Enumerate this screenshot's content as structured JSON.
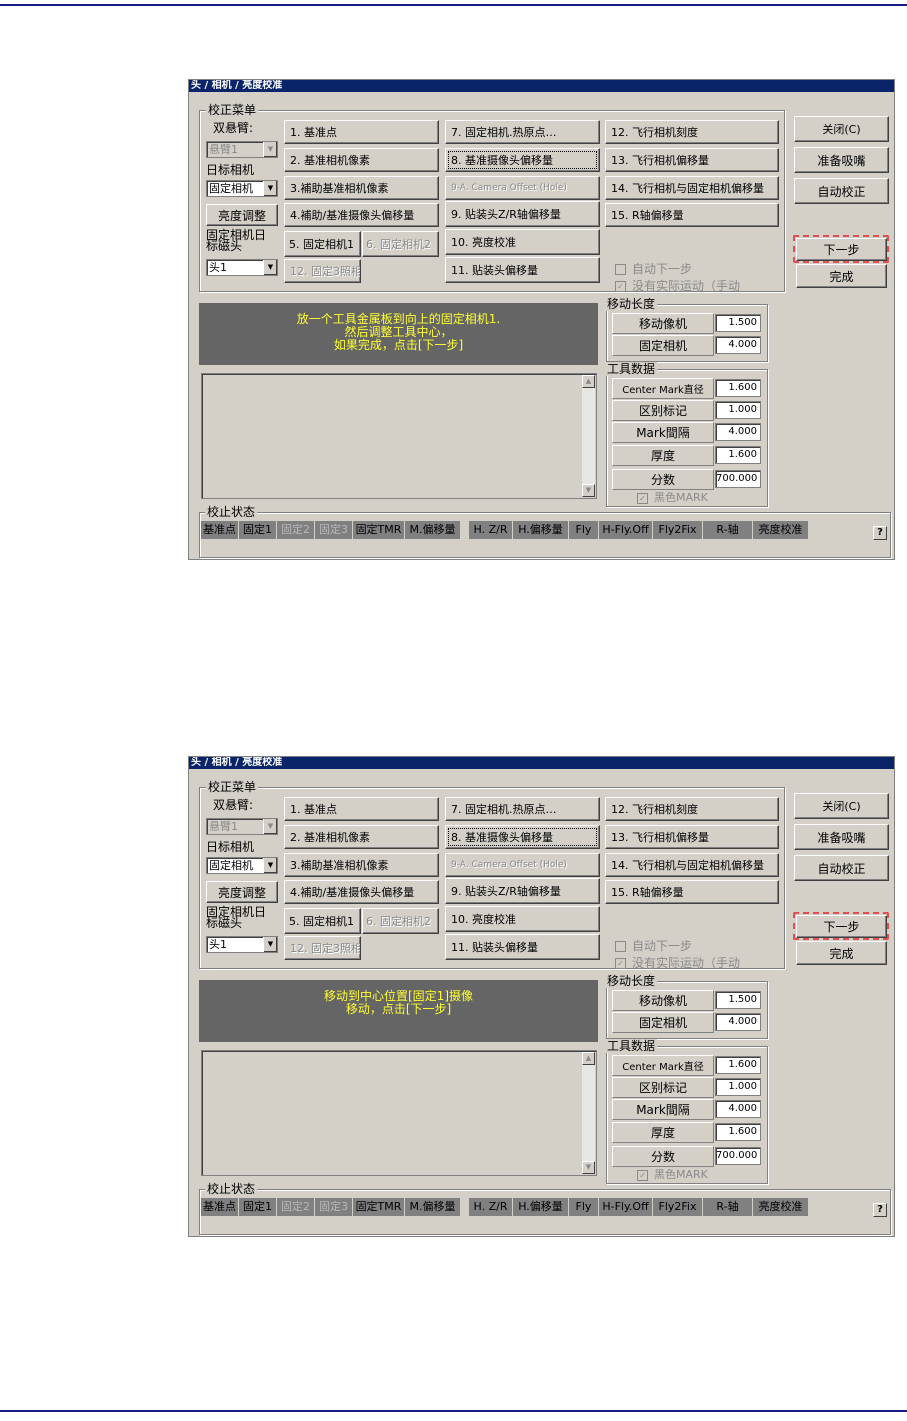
{
  "colors": {
    "title_bar": "#0a246a",
    "message_bg": "#656565",
    "message_text": "#ffff33",
    "highlight": "#e05050"
  },
  "screens": [
    {
      "title": "头 / 相机 / 亮度校准",
      "menu_group": "校正菜单",
      "dual_arm_label": "双悬臂:",
      "arm_select": "悬臂1",
      "target_camera_label": "日标相机",
      "target_camera_select": "固定相机",
      "brightness_button": "亮度调整",
      "fixed_camera_label": "固定相机日标磁头",
      "head_select": "头1",
      "col1": [
        "1. 基准点",
        "2. 基准相机像素",
        "3.補助基准相机像素",
        "4.補助/基准摄像头偏移量"
      ],
      "fixed_cam1": "5. 固定相机1",
      "fixed_cam2": "6. 固定相机2",
      "fixed_cam3": "12. 固定3照相",
      "col2": [
        "7. 固定相机.热原点…",
        "8. 基准摄像头偏移量",
        "9-A. Camera Offset (Hole)",
        "9. 贴装头Z/R轴偏移量",
        "10. 亮度校准",
        "11. 贴装头偏移量"
      ],
      "col3": [
        "12. 飞行相机刻度",
        "13. 飞行相机偏移量",
        "14. 飞行相机与固定相机偏移量",
        "15. R轴偏移量"
      ],
      "auto_next": "自动下一步",
      "no_motion": "没有实际运动（手动",
      "close": "关闭(C)",
      "prepare_nozzle": "准备吸嘴",
      "auto_calibrate": "自动校正",
      "next_step": "下一步",
      "done": "完成",
      "message": [
        "放一个工具金属板到向上的固定相机1.",
        "然后调整工具中心，",
        "如果完成，点击[下一步]"
      ],
      "move_length_group": "移动长度",
      "move_camera_label": "移动像机",
      "move_camera_value": "1.500",
      "fixed_camera_move_label": "固定相机",
      "fixed_camera_move_value": "4.000",
      "tool_data_group": "工具数据",
      "tool_rows": [
        {
          "label": "Center Mark直径",
          "value": "1.600"
        },
        {
          "label": "区别标记",
          "value": "1.000"
        },
        {
          "label": "Mark間隔",
          "value": "4.000"
        },
        {
          "label": "厚度",
          "value": "1.600"
        },
        {
          "label": "分数",
          "value": "700.000"
        }
      ],
      "black_mark": "黑色MARK",
      "status_group": "校止状态",
      "status": [
        "基准点",
        "固定1",
        "固定2",
        "固定3",
        "固定TMR",
        "M.偏移量",
        "H. Z/R",
        "H.偏移量",
        "Fly",
        "H-Fly.Off",
        "Fly2Fix",
        "R-轴",
        "亮度校准"
      ],
      "help": "?"
    },
    {
      "title": "头 / 相机 / 亮度校准",
      "menu_group": "校正菜单",
      "dual_arm_label": "双悬臂:",
      "arm_select": "悬臂1",
      "target_camera_label": "日标相机",
      "target_camera_select": "固定相机",
      "brightness_button": "亮度调整",
      "fixed_camera_label": "固定相机日标磁头",
      "head_select": "头1",
      "col1": [
        "1. 基准点",
        "2. 基准相机像素",
        "3.補助基准相机像素",
        "4.補助/基准摄像头偏移量"
      ],
      "fixed_cam1": "5. 固定相机1",
      "fixed_cam2": "6. 固定相机2",
      "fixed_cam3": "12. 固定3照相",
      "col2": [
        "7. 固定相机.热原点…",
        "8. 基准摄像头偏移量",
        "9-A. Camera Offset (Hole)",
        "9. 贴装头Z/R轴偏移量",
        "10. 亮度校准",
        "11. 贴装头偏移量"
      ],
      "col3": [
        "12. 飞行相机刻度",
        "13. 飞行相机偏移量",
        "14. 飞行相机与固定相机偏移量",
        "15. R轴偏移量"
      ],
      "auto_next": "自动下一步",
      "no_motion": "没有实际运动（手动",
      "close": "关闭(C)",
      "prepare_nozzle": "准备吸嘴",
      "auto_calibrate": "自动校正",
      "next_step": "下一步",
      "done": "完成",
      "message": [
        "移动到中心位置[固定1]摄像",
        "移动，点击[下一步]"
      ],
      "move_length_group": "移动长度",
      "move_camera_label": "移动像机",
      "move_camera_value": "1.500",
      "fixed_camera_move_label": "固定相机",
      "fixed_camera_move_value": "4.000",
      "tool_data_group": "工具数据",
      "tool_rows": [
        {
          "label": "Center Mark直径",
          "value": "1.600"
        },
        {
          "label": "区别标记",
          "value": "1.000"
        },
        {
          "label": "Mark間隔",
          "value": "4.000"
        },
        {
          "label": "厚度",
          "value": "1.600"
        },
        {
          "label": "分数",
          "value": "700.000"
        }
      ],
      "black_mark": "黑色MARK",
      "status_group": "校止状态",
      "status": [
        "基准点",
        "固定1",
        "固定2",
        "固定3",
        "固定TMR",
        "M.偏移量",
        "H. Z/R",
        "H.偏移量",
        "Fly",
        "H-Fly.Off",
        "Fly2Fix",
        "R-轴",
        "亮度校准"
      ],
      "help": "?"
    }
  ]
}
